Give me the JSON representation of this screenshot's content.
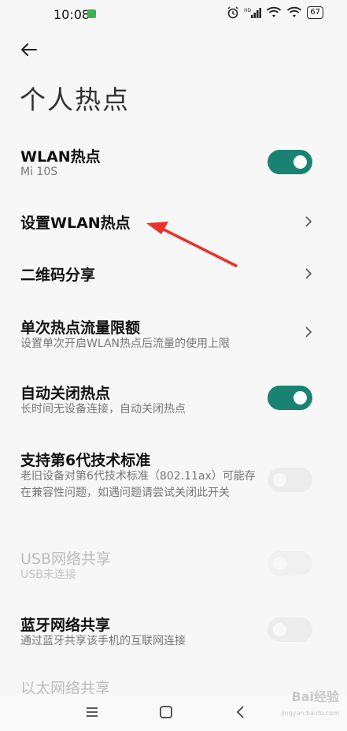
{
  "status": {
    "time": "10:08",
    "battery": "67",
    "network": "HD"
  },
  "page": {
    "title": "个人热点"
  },
  "rows": {
    "wlan_hotspot": {
      "title": "WLAN热点",
      "subtitle": "Mi 10S",
      "toggle": "on"
    },
    "setup_wlan": {
      "title": "设置WLAN热点"
    },
    "qr_share": {
      "title": "二维码分享"
    },
    "data_limit": {
      "title": "单次热点流量限额",
      "subtitle": "设置单次开启WLAN热点后流量的使用上限"
    },
    "auto_off": {
      "title": "自动关闭热点",
      "subtitle": "长时间无设备连接，自动关闭热点",
      "toggle": "on"
    },
    "wifi6": {
      "title": "支持第6代技术标准",
      "subtitle": "老旧设备对第6代技术标准（802.11ax）可能存在兼容性问题，如遇问题请尝试关闭此开关",
      "toggle": "off"
    },
    "usb_share": {
      "title": "USB网络共享",
      "subtitle": "USB未连接",
      "toggle": "off",
      "enabled": false
    },
    "bt_share": {
      "title": "蓝牙网络共享",
      "subtitle": "通过蓝牙共享该手机的互联网连接",
      "toggle": "off"
    },
    "eth_share": {
      "title": "以太网络共享",
      "enabled": false
    }
  },
  "watermark": {
    "text": "Bai经验",
    "sub": "jingyan.baidu.com"
  },
  "colors": {
    "accent": "#1a8272",
    "annotation_arrow": "#e8322b"
  }
}
